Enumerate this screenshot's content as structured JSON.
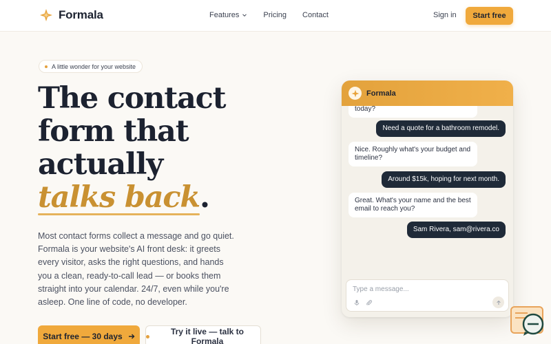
{
  "brand": {
    "name": "Formala",
    "accent": "#f0a93c",
    "dark": "#1c2230"
  },
  "nav": {
    "links": [
      {
        "label": "Features",
        "has_dropdown": true
      },
      {
        "label": "Pricing"
      },
      {
        "label": "Contact"
      }
    ],
    "signin": "Sign in",
    "cta": "Start free"
  },
  "hero": {
    "pill": "A little wonder for your website",
    "headline": {
      "line1": "The contact",
      "line2": "form that",
      "line3": "actually",
      "accent": "talks back",
      "period": "."
    },
    "subcopy": "Most contact forms collect a message and go quiet. Formala is your website's AI front desk: it greets every visitor, asks the right questions, and hands you a clean, ready-to-call lead — or books them straight into your calendar. 24/7, even while you're asleep. One line of code, no developer.",
    "cta_primary": "Start free — 30 days",
    "cta_secondary": "Try it live — talk to Formala"
  },
  "chat": {
    "title": "Formala",
    "messages": [
      {
        "from": "bot",
        "text": "today?"
      },
      {
        "from": "user",
        "text": "Need a quote for a bathroom remodel."
      },
      {
        "from": "bot",
        "text": "Nice. Roughly what's your budget and timeline?"
      },
      {
        "from": "user",
        "text": "Around $15k, hoping for next month."
      },
      {
        "from": "bot",
        "text": "Great. What's your name and the best email to reach you?"
      },
      {
        "from": "user",
        "text": "Sam Rivera, sam@rivera.co"
      }
    ],
    "input_placeholder": "Type a message...",
    "icons": [
      "mic-icon",
      "paperclip-icon",
      "send-arrow-icon"
    ]
  }
}
